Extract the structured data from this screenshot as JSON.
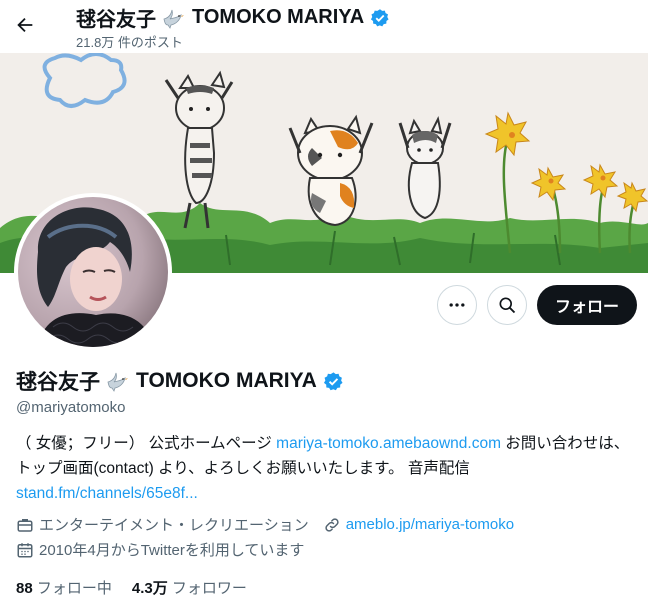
{
  "header": {
    "name_jp": "毬谷友子",
    "name_en": "TOMOKO MARIYA",
    "posts": "21.8万 件のポスト"
  },
  "profile": {
    "name_jp": "毬谷友子",
    "name_en": "TOMOKO MARIYA",
    "handle": "@mariyatomoko",
    "bio_text_1": "（ 女優；フリー） 公式ホームページ ",
    "bio_link_1": "mariya-tomoko.amebaownd.com",
    "bio_text_2": " お問い合わせは、トップ画面(contact) より、よろしくお願いいたします。 音声配信",
    "bio_link_2": "stand.fm/channels/65e8f...",
    "category": "エンターテイメント・レクリエーション",
    "website": "ameblo.jp/mariya-tomoko",
    "joined": "2010年4月からTwitterを利用しています",
    "following_count": "88",
    "following_label": "フォロー中",
    "followers_count": "4.3万",
    "followers_label": "フォロワー"
  },
  "actions": {
    "follow_label": "フォロー"
  },
  "colors": {
    "accent": "#1d9bf0",
    "text": "#0f1419",
    "muted": "#536471",
    "button_bg": "#0f1419"
  },
  "icons": [
    "back-arrow-icon",
    "dove-icon",
    "verified-badge-icon",
    "more-icon",
    "search-icon",
    "briefcase-icon",
    "link-icon",
    "calendar-icon"
  ]
}
